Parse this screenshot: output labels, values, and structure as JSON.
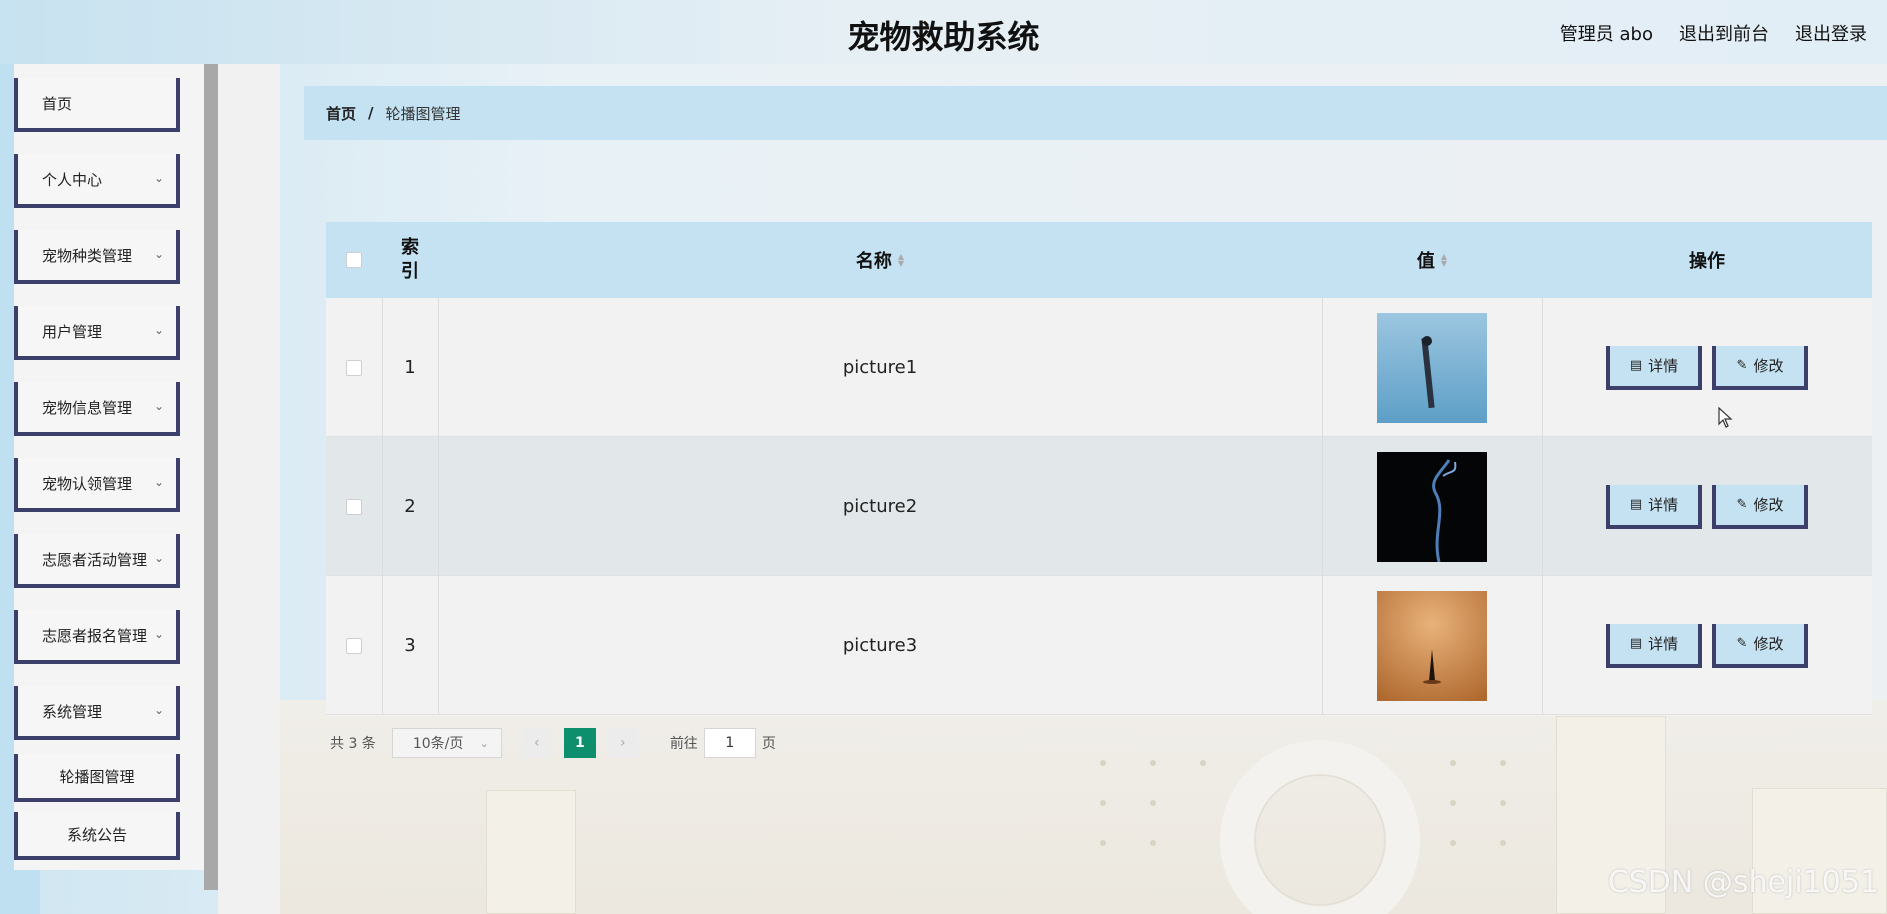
{
  "header": {
    "title": "宠物救助系统",
    "admin": "管理员 abo",
    "exit_front": "退出到前台",
    "logout": "退出登录"
  },
  "sidebar": {
    "items": [
      {
        "label": "首页",
        "has_arrow": false
      },
      {
        "label": "个人中心",
        "has_arrow": true
      },
      {
        "label": "宠物种类管理",
        "has_arrow": true
      },
      {
        "label": "用户管理",
        "has_arrow": true
      },
      {
        "label": "宠物信息管理",
        "has_arrow": true
      },
      {
        "label": "宠物认领管理",
        "has_arrow": true
      },
      {
        "label": "志愿者活动管理",
        "has_arrow": true
      },
      {
        "label": "志愿者报名管理",
        "has_arrow": true
      },
      {
        "label": "系统管理",
        "has_arrow": true
      },
      {
        "label": "轮播图管理",
        "has_arrow": false
      },
      {
        "label": "系统公告",
        "has_arrow": false
      }
    ]
  },
  "breadcrumb": {
    "home": "首页",
    "sep": "/",
    "current": "轮播图管理"
  },
  "table": {
    "headers": {
      "index": "索引",
      "name": "名称",
      "value": "值",
      "actions": "操作"
    },
    "rows": [
      {
        "index": "1",
        "name": "picture1",
        "thumb": "blue-sky-figure"
      },
      {
        "index": "2",
        "name": "picture2",
        "thumb": "dark-smoke"
      },
      {
        "index": "3",
        "name": "picture3",
        "thumb": "amber-incense"
      }
    ],
    "detail_label": "详情",
    "edit_label": "修改"
  },
  "pagination": {
    "total": "共 3 条",
    "page_size": "10条/页",
    "current_page": "1",
    "goto_prefix": "前往",
    "goto_value": "1",
    "goto_suffix": "页"
  },
  "watermark": "CSDN @sheji1051",
  "colors": {
    "accent_blue": "#c4e2f2",
    "border_navy": "#3d3f6b",
    "pager_active": "#0d8f6e"
  }
}
